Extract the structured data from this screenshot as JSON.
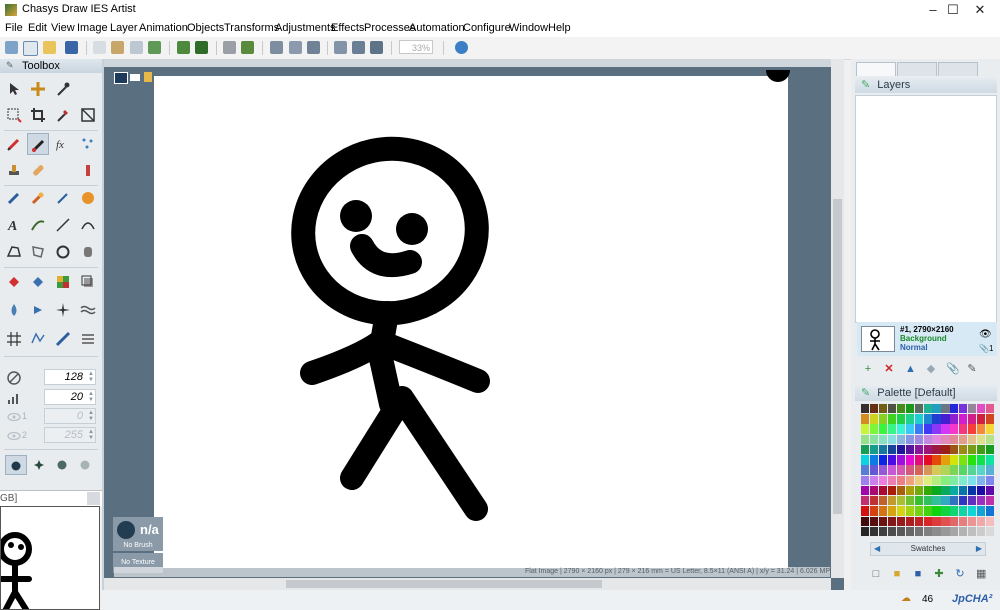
{
  "window": {
    "title": "Chasys Draw IES Artist"
  },
  "menu": [
    "File",
    "Edit",
    "View",
    "Image",
    "Layer",
    "Animation",
    "Objects",
    "Transforms",
    "Adjustments",
    "Effects",
    "Processes",
    "Automation",
    "Configure",
    "Window",
    "Help"
  ],
  "toolbar": {
    "zoom": "33%"
  },
  "toolbox": {
    "title": "Toolbox",
    "size_value": "128",
    "opacity_value": "20",
    "disabled_value_1": "0",
    "disabled_value_2": "255",
    "label_1": "1",
    "label_2": "2"
  },
  "brush_tile": {
    "title": "n/a",
    "caption": "No Brush"
  },
  "texture_tile": {
    "caption": "No Texture"
  },
  "preview": {
    "label": "GB]"
  },
  "status": {
    "text": "Flat Image | 2790 × 2160 px | 279 × 216 mm = US Letter, 8.5×11 (ANSI A) | x/y = 31.24 | 6.026 MP"
  },
  "layers": {
    "title": "Layers",
    "item": {
      "id": "#1, 2790×2160",
      "name": "Background",
      "mode": "Normal",
      "count": "1"
    }
  },
  "palette": {
    "title": "Palette [Default]",
    "swatches_label": "Swatches"
  },
  "footer": {
    "count": "46",
    "brand": "JpCHA²"
  },
  "colors": {
    "accent": "#2d6fb0",
    "canvas_bg": "#5a6f80",
    "layer_name": "#1a8a2a"
  }
}
